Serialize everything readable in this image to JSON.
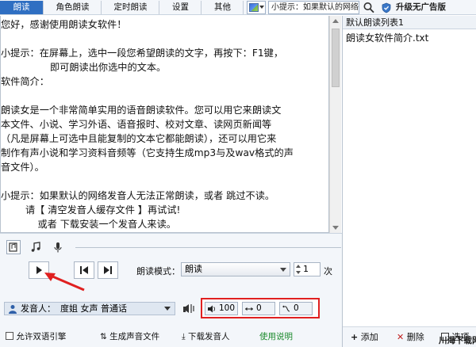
{
  "toolbar": {
    "tabs": [
      "朗读",
      "角色朗读",
      "定时朗读",
      "设置",
      "其他"
    ],
    "active_tab": 0,
    "tip_text": "小提示：如果默认的网络",
    "upgrade_label": "升级无广告版"
  },
  "editor": {
    "lines": [
      "您好，感谢使用朗读女软件！",
      "",
      "小提示：在屏幕上，选中一段您希望朗读的文字，再按下：F1键，",
      "                即可朗读出你选中的文本。",
      "软件简介：",
      "",
      "朗读女是一个非常简单实用的语音朗读软件。您可以用它来朗读文",
      "本文件、小说、学习外语、语音报时、校对文章、读网页新闻等",
      "（凡是屏幕上可选中且能复制的文本它都能朗读），还可以用它来",
      "制作有声小说和学习资料音频等（它支持生成mp3与及wav格式的声",
      "音文件）。",
      "",
      "小提示：如果默认的网络发音人无法正常朗读，或者 跳过不读。",
      "        请【 清空发音人缓存文件 】再试试!",
      "            或者 下载安装一个发音人来读。"
    ]
  },
  "playlist": {
    "header": "默认朗读列表1",
    "items": [
      "朗读女软件简介.txt"
    ],
    "add_label": "添加",
    "delete_label": "删除",
    "options_label": "选项"
  },
  "controls": {
    "mode_label": "朗读模式：",
    "mode_value": "朗读",
    "count_value": "1",
    "count_unit": "次",
    "voice_label": "发音人：",
    "voice_value": "度姐 女声 普通话",
    "volume": "100",
    "speed": "0",
    "pitch": "0",
    "allow_dual_engine": "允许双语引擎",
    "generate_audio": "生成声音文件",
    "download_voice": "下载发音人",
    "help": "使用说明"
  },
  "watermark": "川海下载网",
  "colors": {
    "active_tab_bg": "#2f6fc2",
    "highlight_border": "#e02020",
    "help_link": "#1c8a2d",
    "arrow": "#e02020"
  }
}
